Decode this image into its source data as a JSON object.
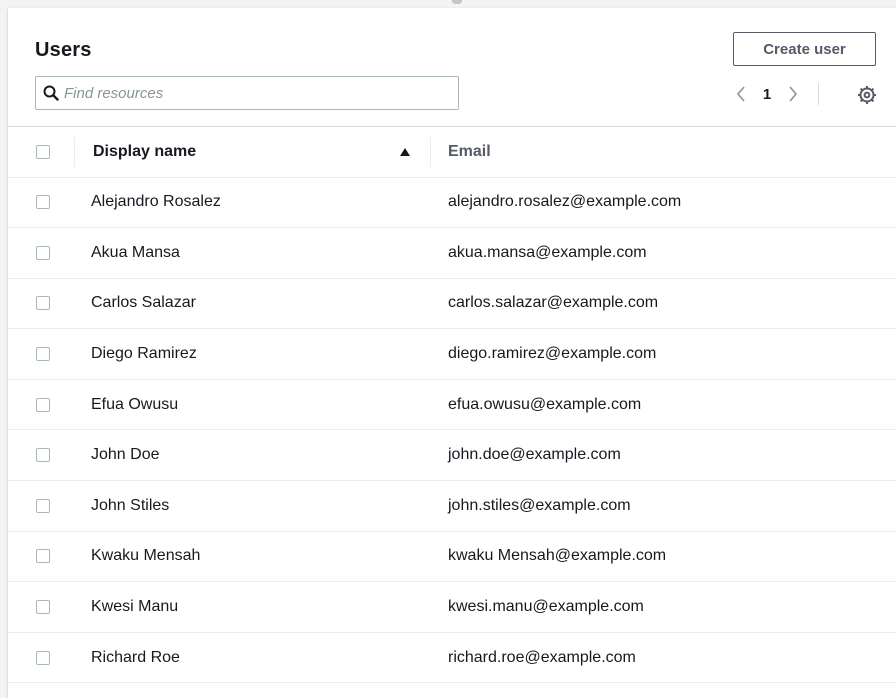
{
  "header": {
    "title": "Users",
    "create_button": "Create user",
    "search_placeholder": "Find resources"
  },
  "pagination": {
    "current_page": "1",
    "prev_icon": "chevron-left-icon",
    "next_icon": "chevron-right-icon",
    "settings_icon": "gear-icon"
  },
  "table": {
    "columns": [
      "Display name",
      "Email"
    ],
    "sort_column": "Display name",
    "sort_direction": "ascending",
    "rows": [
      {
        "name": "Alejandro Rosalez",
        "email": "alejandro.rosalez@example.com"
      },
      {
        "name": "Akua Mansa",
        "email": "akua.mansa@example.com"
      },
      {
        "name": "Carlos Salazar",
        "email": "carlos.salazar@example.com"
      },
      {
        "name": "Diego Ramirez",
        "email": "diego.ramirez@example.com"
      },
      {
        "name": "Efua Owusu",
        "email": "efua.owusu@example.com"
      },
      {
        "name": "John Doe",
        "email": "john.doe@example.com"
      },
      {
        "name": "John Stiles",
        "email": "john.stiles@example.com"
      },
      {
        "name": "Kwaku Mensah",
        "email": "kwaku Mensah@example.com"
      },
      {
        "name": "Kwesi Manu",
        "email": "kwesi.manu@example.com"
      },
      {
        "name": "Richard Roe",
        "email": "richard.roe@example.com"
      }
    ]
  }
}
